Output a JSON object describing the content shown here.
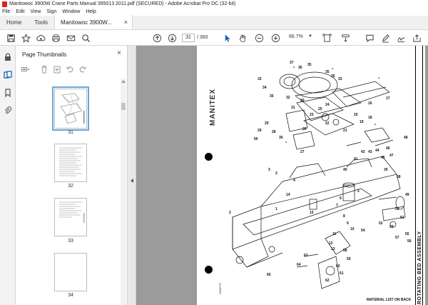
{
  "window": {
    "title": "Manitowoc 3900W Crane Parts Manual 395013 2011.pdf (SECURED) - Adobe Acrobat Pro DC (32-bit)"
  },
  "menu": [
    "File",
    "Edit",
    "View",
    "Sign",
    "Window",
    "Help"
  ],
  "tabs": {
    "home": "Home",
    "tools": "Tools",
    "document": "Manitowoc 3900W..."
  },
  "toolbar": {
    "current_page": "31",
    "total_pages": "/ 360",
    "zoom": "66.7%"
  },
  "panel": {
    "title": "Page Thumbnails",
    "thumbnails": [
      {
        "page": "31",
        "selected": true
      },
      {
        "page": "32",
        "selected": false
      },
      {
        "page": "33",
        "selected": false
      },
      {
        "page": "34",
        "selected": false
      }
    ]
  },
  "document": {
    "brand": "MANITEX",
    "caption": "ROTATING BED ASSEMBLY",
    "footer": "MATERIAL LIST ON BACK",
    "corner": "SHEETS",
    "part_labels": [
      "37",
      "36",
      "35",
      "33",
      "34",
      "33",
      "32",
      "30",
      "31",
      "29",
      "28",
      "27",
      "26",
      "25",
      "24",
      "23",
      "22",
      "21",
      "20",
      "19",
      "18",
      "17",
      "16",
      "1",
      "2",
      "3",
      "4",
      "5",
      "6",
      "7",
      "8",
      "9",
      "10",
      "11",
      "12",
      "13",
      "14",
      "15",
      "38",
      "39",
      "40",
      "41",
      "42",
      "43",
      "44",
      "45",
      "46",
      "47",
      "48",
      "49",
      "50",
      "51",
      "52",
      "53",
      "54",
      "55",
      "56",
      "57",
      "58",
      "59",
      "60",
      "61",
      "62",
      "63",
      "64",
      "65"
    ]
  },
  "colors": {
    "acrobat_red": "#d9261c",
    "selection_blue": "#6aa5d9",
    "doc_background": "#9b9b9b"
  }
}
